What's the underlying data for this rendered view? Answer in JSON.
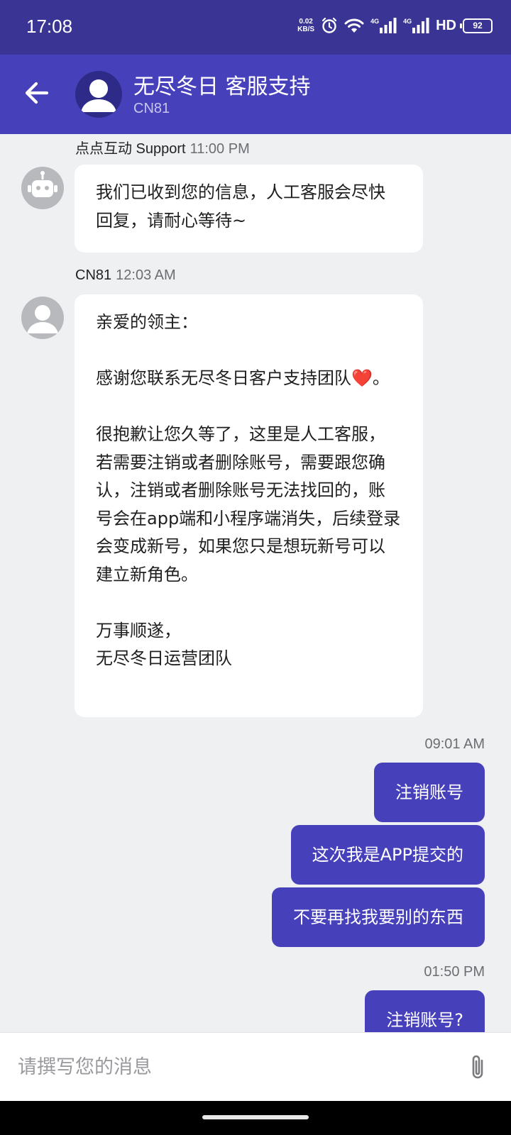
{
  "status_bar": {
    "time": "17:08",
    "net_speed_value": "0.02",
    "net_speed_unit": "KB/S",
    "signal1_label": "4G",
    "signal2_label": "4G",
    "hd_label": "HD",
    "battery": "92"
  },
  "header": {
    "back_icon": "arrow-left-icon",
    "title": "无尽冬日 客服支持",
    "subtitle": "CN81"
  },
  "messages": {
    "m1": {
      "sender": "点点互动 Support",
      "time": "11:00 PM",
      "avatar_icon": "robot-icon",
      "text": "我们已收到您的信息，人工客服会尽快回复，请耐心等待~"
    },
    "m2": {
      "sender": "CN81",
      "time": "12:03 AM",
      "avatar_icon": "person-icon",
      "text": "亲爱的领主：\n\n感谢您联系无尽冬日客户支持团队❤️。\n\n很抱歉让您久等了，这里是人工客服，若需要注销或者删除账号，需要跟您确认，注销或者删除账号无法找回的，账号会在app端和小程序端消失，后续登录会变成新号，如果您只是想玩新号可以建立新角色。\n\n万事顺遂，\n无尽冬日运营团队"
    },
    "out_time_1": "09:01 AM",
    "o1": "注销账号",
    "o2": "这次我是APP提交的",
    "o3": "不要再找我要别的东西",
    "out_time_2": "01:50 PM",
    "o4": "注销账号?"
  },
  "composer": {
    "placeholder": "请撰写您的消息",
    "value": "",
    "attach_icon": "paperclip-icon"
  },
  "colors": {
    "status_bar_bg": "#3a3594",
    "header_bg": "#4740bb",
    "outgoing_bubble": "#4740bb",
    "chat_bg": "#eef0f2"
  }
}
